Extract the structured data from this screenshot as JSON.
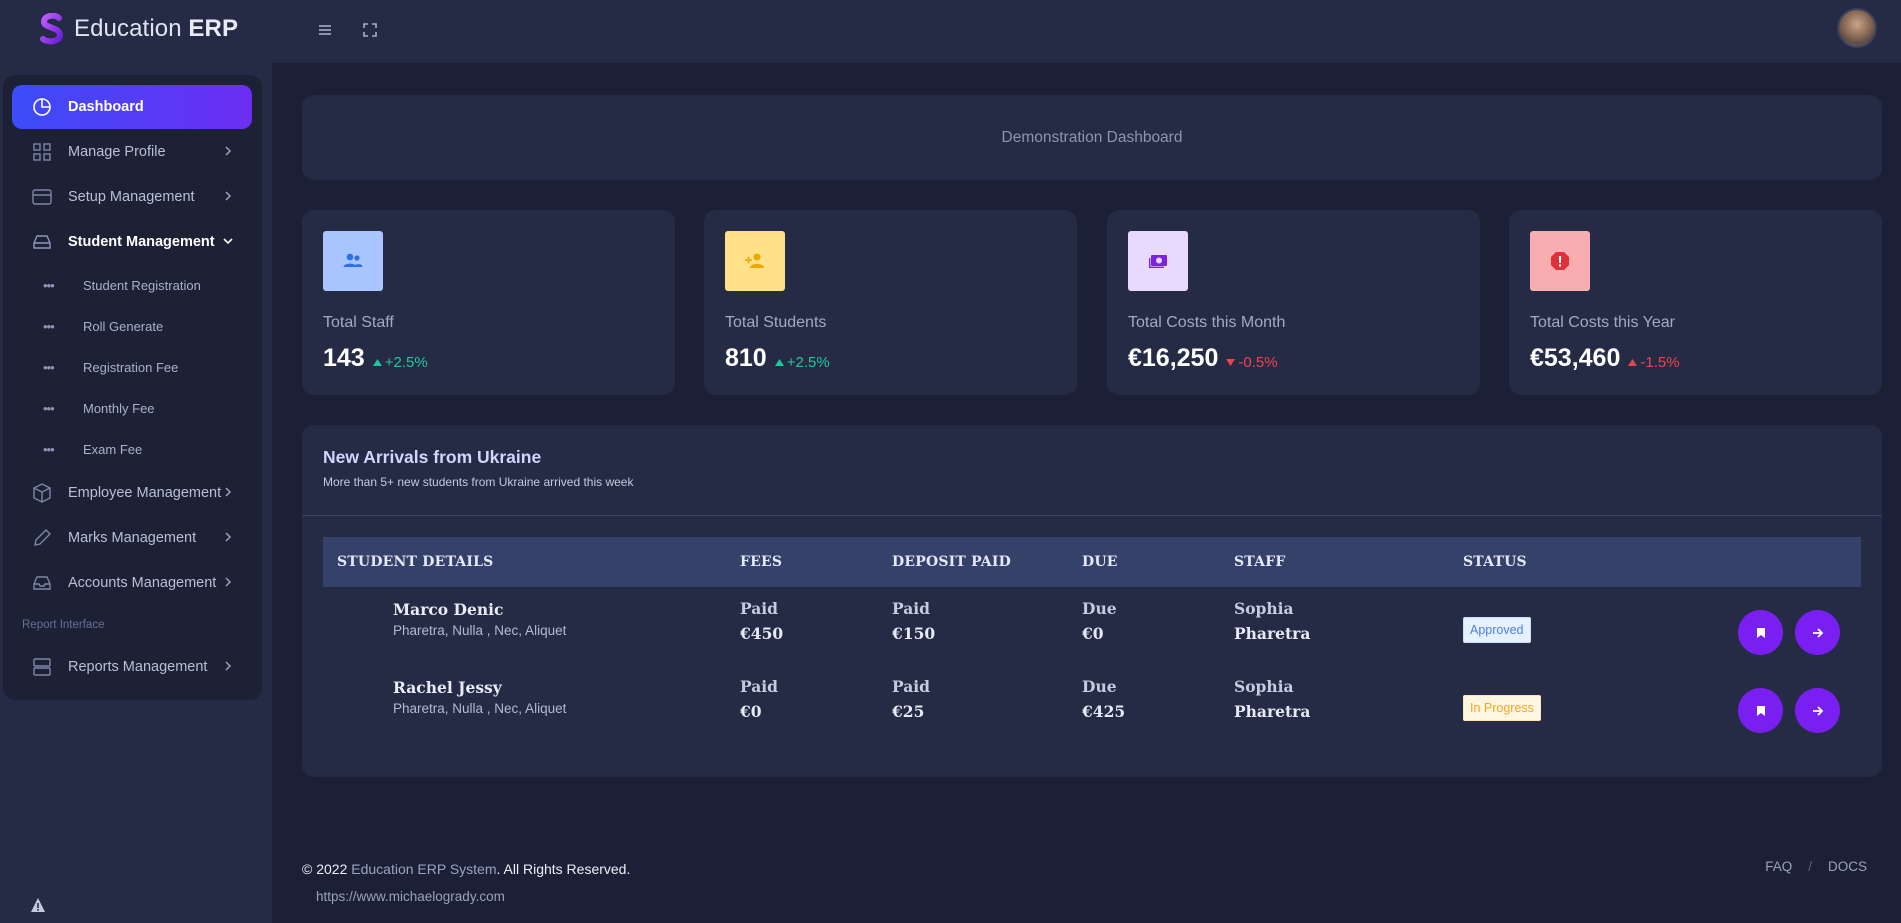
{
  "app": {
    "brand_light": "Education ",
    "brand_bold": "ERP"
  },
  "colors": {
    "accent": "#7a1ff2",
    "active_start": "#3b4cf8",
    "active_end": "#6d2ef4",
    "positive": "#21c69a",
    "negative": "#f0434e"
  },
  "sidebar": {
    "items": [
      {
        "label": "Dashboard",
        "icon": "pie-chart-icon"
      },
      {
        "label": "Manage Profile",
        "icon": "grid-icon"
      },
      {
        "label": "Setup Management",
        "icon": "credit-card-icon"
      },
      {
        "label": "Student Management",
        "icon": "hard-drive-icon"
      },
      {
        "label": "Employee Management",
        "icon": "box-icon"
      },
      {
        "label": "Marks Management",
        "icon": "edit-icon"
      },
      {
        "label": "Accounts Management",
        "icon": "inbox-icon"
      },
      {
        "label": "Reports Management",
        "icon": "server-icon"
      }
    ],
    "student_sub": [
      "Student Registration",
      "Roll Generate",
      "Registration Fee",
      "Monthly Fee",
      "Exam Fee"
    ],
    "section_label": "Report Interface"
  },
  "hero": {
    "text": "Demonstration Dashboard"
  },
  "stats": [
    {
      "title": "Total Staff",
      "value": "143",
      "change": "+2.5%",
      "trend": "up",
      "badge_bg": "#a8c5ff",
      "icon_color": "#2f6fe0",
      "icon": "users-icon"
    },
    {
      "title": "Total Students",
      "value": "810",
      "change": "+2.5%",
      "trend": "up",
      "badge_bg": "#ffe18a",
      "icon_color": "#f0a800",
      "icon": "user-plus-icon"
    },
    {
      "title": "Total Costs this Month",
      "value": "€16,250",
      "change": "-0.5%",
      "trend": "down",
      "badge_bg": "#e8d9ff",
      "icon_color": "#7a22e0",
      "icon": "money-icon"
    },
    {
      "title": "Total Costs this Year",
      "value": "€53,460",
      "change": "-1.5%",
      "trend": "up-red",
      "badge_bg": "#f8aeb0",
      "icon_color": "#e0303a",
      "icon": "alert-icon"
    }
  ],
  "arrivals": {
    "title": "New Arrivals from Ukraine",
    "subtitle": "More than 5+ new students from Ukraine arrived this week",
    "columns": [
      "STUDENT DETAILS",
      "FEES",
      "DEPOSIT PAID",
      "DUE",
      "STAFF",
      "STATUS"
    ],
    "rows": [
      {
        "name": "Marco Denic",
        "desc": "Pharetra, Nulla , Nec, Aliquet",
        "fees_label": "Paid",
        "fees": "€450",
        "deposit_label": "Paid",
        "deposit": "€150",
        "due_label": "Due",
        "due": "€0",
        "staff_first": "Sophia",
        "staff_last": "Pharetra",
        "status": "Approved"
      },
      {
        "name": "Rachel Jessy",
        "desc": "Pharetra, Nulla , Nec, Aliquet",
        "fees_label": "Paid",
        "fees": "€0",
        "deposit_label": "Paid",
        "deposit": "€25",
        "due_label": "Due",
        "due": "€425",
        "staff_first": "Sophia",
        "staff_last": "Pharetra",
        "status": "In Progress"
      }
    ]
  },
  "footer": {
    "prefix": "© 2022 ",
    "link": "Education ERP System",
    "suffix": ". All Rights Reserved.",
    "url": "https://www.michaelogrady.com",
    "faq": "FAQ",
    "divider": "/",
    "docs": "DOCS"
  }
}
